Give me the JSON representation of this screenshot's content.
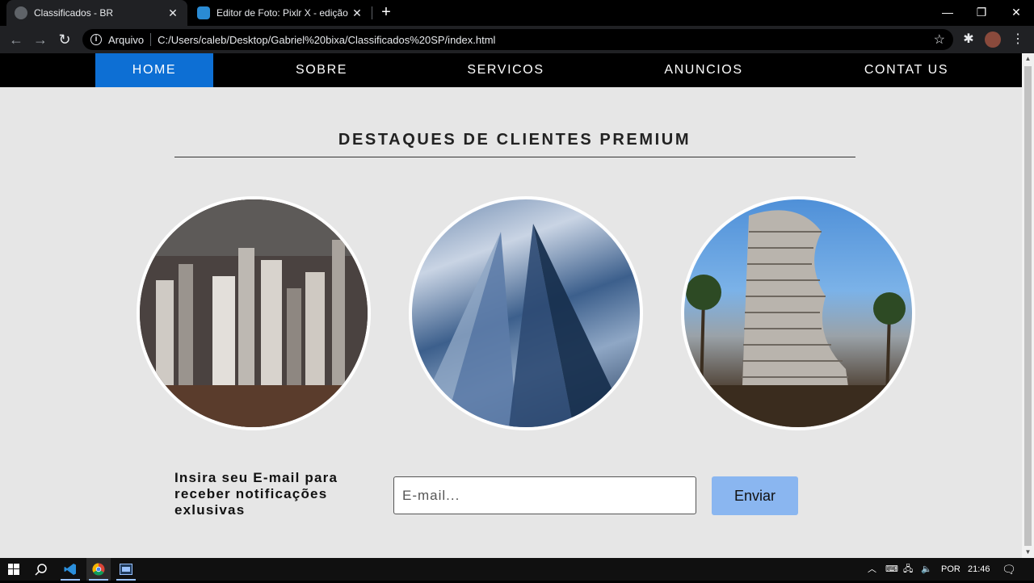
{
  "browser": {
    "tabs": [
      {
        "title": "Classificados - BR",
        "close": "✕"
      },
      {
        "title": "Editor de Foto: Pixlr X - edição de",
        "close": "✕"
      }
    ],
    "new_tab": "+",
    "window_controls": {
      "minimize": "—",
      "restore": "❐",
      "close": "✕"
    },
    "nav": {
      "back": "←",
      "forward": "→",
      "reload": "↻"
    },
    "address": {
      "scheme_label": "Arquivo",
      "url": "C:/Users/caleb/Desktop/Gabriel%20bixa/Classificados%20SP/index.html"
    },
    "star": "☆",
    "extensions": "✱",
    "menu": "⋮"
  },
  "site": {
    "nav": {
      "items": [
        "HOME",
        "SOBRE",
        "SERVICOS",
        "ANUNCIOS",
        "CONTAT US"
      ],
      "active_index": 0,
      "active_color": "#0d6fd4"
    },
    "heading": "DESTAQUES DE CLIENTES PREMIUM",
    "newsletter": {
      "prompt": "Insira seu E-mail para receber notificações exlusivas",
      "placeholder": "E-mail...",
      "button": "Enviar",
      "button_color": "#8ab6f0"
    }
  },
  "taskbar": {
    "language": "POR",
    "time": "21:46"
  }
}
